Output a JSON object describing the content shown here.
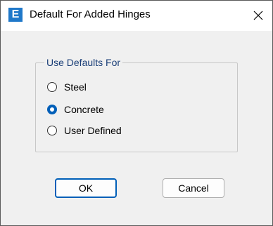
{
  "window": {
    "title": "Default For Added Hinges",
    "app_icon_letter": "E",
    "accent_color": "#005fb8",
    "icons": {
      "app": "app-icon",
      "close": "close-icon"
    }
  },
  "group": {
    "label": "Use Defaults For",
    "options": [
      {
        "label": "Steel",
        "checked": false
      },
      {
        "label": "Concrete",
        "checked": true
      },
      {
        "label": "User Defined",
        "checked": false
      }
    ]
  },
  "buttons": {
    "ok_label": "OK",
    "cancel_label": "Cancel"
  }
}
